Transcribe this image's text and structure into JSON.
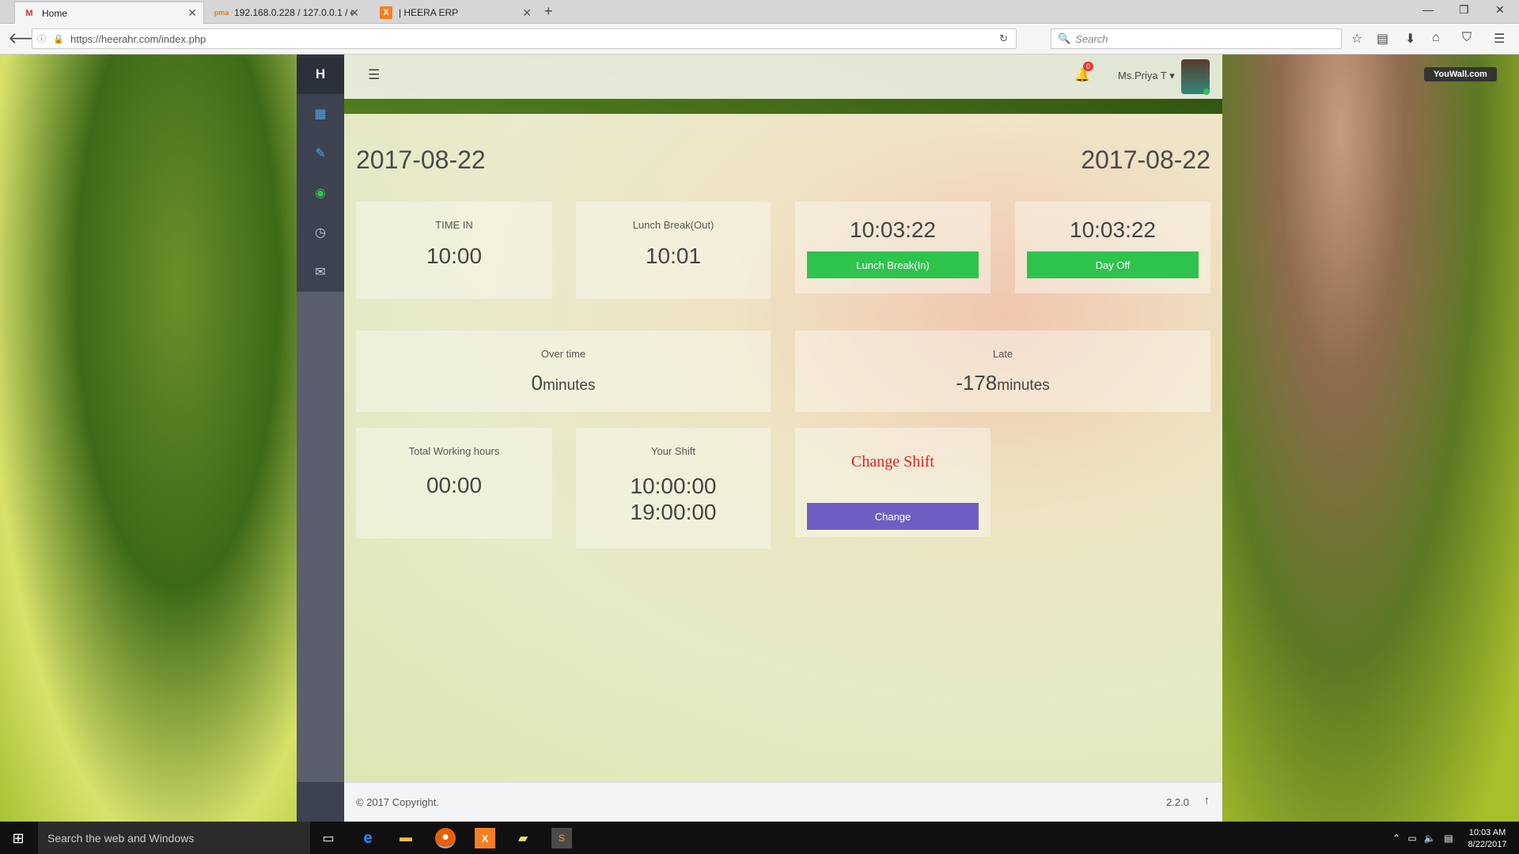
{
  "browser": {
    "tabs": [
      {
        "label": "Home",
        "favicon": "gmail-icon"
      },
      {
        "label": "192.168.0.228 / 127.0.0.1 / er",
        "favicon": "phpmyadmin-icon"
      },
      {
        "label": "| HEERA ERP",
        "favicon": "xampp-icon"
      }
    ],
    "url": "https://heerahr.com/index.php",
    "search_placeholder": "Search"
  },
  "app": {
    "brand": "H",
    "user_name": "Ms.Priya T",
    "notification_count": "0",
    "dates": {
      "left": "2017-08-22",
      "right": "2017-08-22"
    },
    "cards": {
      "time_in": {
        "label": "TIME IN",
        "value": "10:00"
      },
      "lunch_out": {
        "label": "Lunch Break(Out)",
        "value": "10:01"
      },
      "lunch_in": {
        "time": "10:03:22",
        "button": "Lunch Break(In)"
      },
      "day_off": {
        "time": "10:03:22",
        "button": "Day Off"
      },
      "overtime": {
        "label": "Over time",
        "value": "0",
        "unit": "minutes"
      },
      "late": {
        "label": "Late",
        "value": "-178",
        "unit": "minutes"
      },
      "working_hours": {
        "label": "Total Working hours",
        "value": "00:00"
      },
      "shift": {
        "label": "Your Shift",
        "start": "10:00:00",
        "end": "19:00:00"
      },
      "change_shift": {
        "title": "Change Shift",
        "button": "Change"
      }
    },
    "footer": {
      "copyright": "© 2017 Copyright.",
      "version": "2.2.0"
    }
  },
  "desktop": {
    "watermark": "YouWall.com",
    "taskbar_search": "Search the web and Windows",
    "clock_time": "10:03 AM",
    "clock_date": "8/22/2017"
  },
  "colors": {
    "green": "#2ec34d",
    "purple": "#6f5ec1",
    "red_title": "#e02020",
    "sidebar": "#3d4250"
  }
}
